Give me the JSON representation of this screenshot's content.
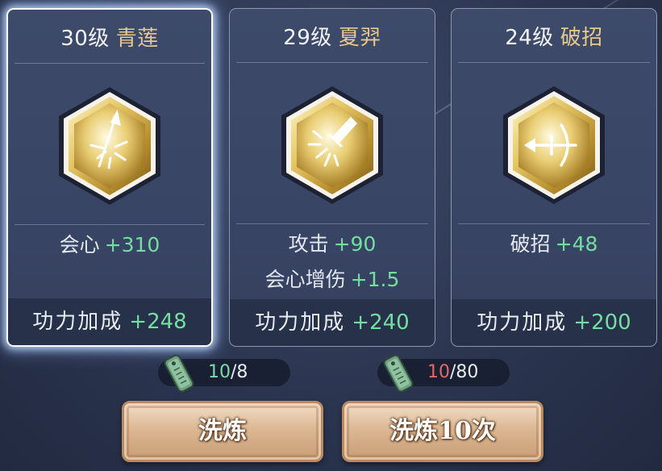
{
  "cards": [
    {
      "level": "30级",
      "name": "青莲",
      "icon": "sword-burst-icon",
      "stats": [
        {
          "name": "会心",
          "value": "+310"
        }
      ],
      "bonus_label": "功力加成",
      "bonus_value": "+248",
      "selected": true
    },
    {
      "level": "29级",
      "name": "夏羿",
      "icon": "broken-sword-icon",
      "stats": [
        {
          "name": "攻击",
          "value": "+90"
        },
        {
          "name": "会心增伤",
          "value": "+1.5"
        }
      ],
      "bonus_label": "功力加成",
      "bonus_value": "+240",
      "selected": false
    },
    {
      "level": "24级",
      "name": "破招",
      "icon": "crossbow-arrow-icon",
      "stats": [
        {
          "name": "破招",
          "value": "+48"
        }
      ],
      "bonus_label": "功力加成",
      "bonus_value": "+200",
      "selected": false
    }
  ],
  "costs": [
    {
      "icon": "jade-tablet-icon",
      "have": "10",
      "need": "/8"
    },
    {
      "icon": "jade-tablet-icon",
      "have": "10",
      "need": "/80"
    }
  ],
  "buttons": {
    "refine": "洗炼",
    "refine10": "洗炼10次"
  },
  "colors": {
    "stat_value": "#74dea0",
    "skill_name": "#e7c98c",
    "insufficient": "#e46767"
  }
}
